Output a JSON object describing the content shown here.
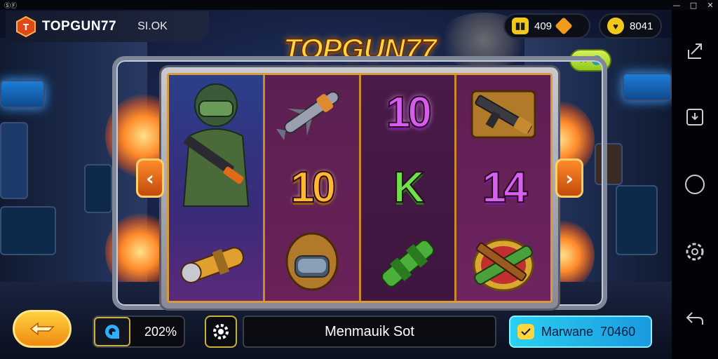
{
  "status_bar": {
    "left_text": "ⓈⒻ"
  },
  "header": {
    "brand_name": "TOPGUN77",
    "brand_sub": "SI.OK",
    "coins_value": "409",
    "gems_value": "8041"
  },
  "game_title": "TOPGUN77",
  "reels": {
    "reel1": [
      "soldier",
      "rocket"
    ],
    "reel2": [
      "missile",
      "10",
      "helmet-soldier"
    ],
    "reel3": [
      "10",
      "K",
      "green-bazooka"
    ],
    "reel4": [
      "rifle-crate",
      "14",
      "gun-shield"
    ]
  },
  "symbols_text": {
    "ten_purple": "10",
    "ten_gold": "10",
    "k": "K",
    "fourteen": "14"
  },
  "controls": {
    "bet_percent": "202%",
    "spin_label": "Menmauik Sot",
    "win_label": "Marwane",
    "win_value": "70460"
  },
  "colors": {
    "accent": "#ffd640",
    "reel_bg": "#6a1f4a",
    "win_button": "#2ad0f0"
  }
}
